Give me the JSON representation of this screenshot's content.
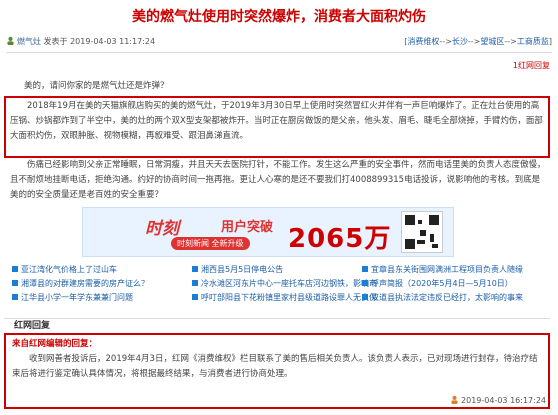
{
  "title": "美的燃气灶使用时突然爆炸，消费者大面积灼伤",
  "meta": {
    "user": "燃气灶",
    "posted": "发表于 2019-04-03 11:17:24"
  },
  "breadcrumb": {
    "open": "[",
    "items": [
      "消费维权",
      "长沙",
      "望城区",
      "工商质监"
    ],
    "sep": "-->",
    "close": "]"
  },
  "hongxiang": "1红网回复",
  "question": "美的，请问你家的是燃气灶还是炸弹？",
  "p1": "2018年19月在美的天猫旗舰店购买的美的燃气灶，于2019年3月30日早上使用时突然冒红火并伴有一声巨响爆炸了。正在灶台使用的高压锅、炒锅都炸到了半空中，美的灶的两个双X型支架都被炸开。当时正在厨房做饭的是父亲，他头发、眉毛、睫毛全部烧掉，手臂灼伤，面部大面积灼伤，双眼肿胀、视物模糊，再叙难受、跟泪鼻涕直流。",
  "p2": "伤痛已经影响到父亲正常睡眠，日常洞瘦，并且天天去医院打针，不能工作。发生这么严重的安全事件，然而电话里美的负责人态度傲慢，且不耐烦地挂断电话，拒绝沟通。约好的协商时间一拖再拖。更让人心寒的是还不要我们打4008899315电话投诉，说影响他的考核。到底是美的的安全质量还是老百姓的安全重要？",
  "banner": {
    "brand": "时刻",
    "head": "用户突破",
    "sub": "时刻新闻 全新升级",
    "num": "2065万"
  },
  "links": [
    "亚江湾化气价格上了过山车",
    "湘西县5月5日停电公告",
    "宜章县东关街围网满洲工程项目负责人随缘",
    "湘潭县的对群建房需要的房产证么？",
    "冷水滩区河东片中心一座托车店河边钢铁，影响市",
    "呼声简报（2020年5月4日—5月10日）",
    "江华县小学一年学东兼兼门问题",
    "呼叮部阳县下花粉镇里家村县级道路设罪人无良保",
    "双道县执法法定违反已经打，太影响的事来"
  ],
  "reply": {
    "header": "红网回复",
    "from": "来自红网编辑的回复：",
    "body": "收到网善者投诉后，2019年4月3日，红网《消费维权》栏目联系了美的售后相关负责人。该负责人表示，已对现场进行封存，待治疗结束后将进行鉴定确认具体情况，将根据最终结果，与消费者进行协商处理。",
    "time": "2019-04-03 16:17:24"
  }
}
